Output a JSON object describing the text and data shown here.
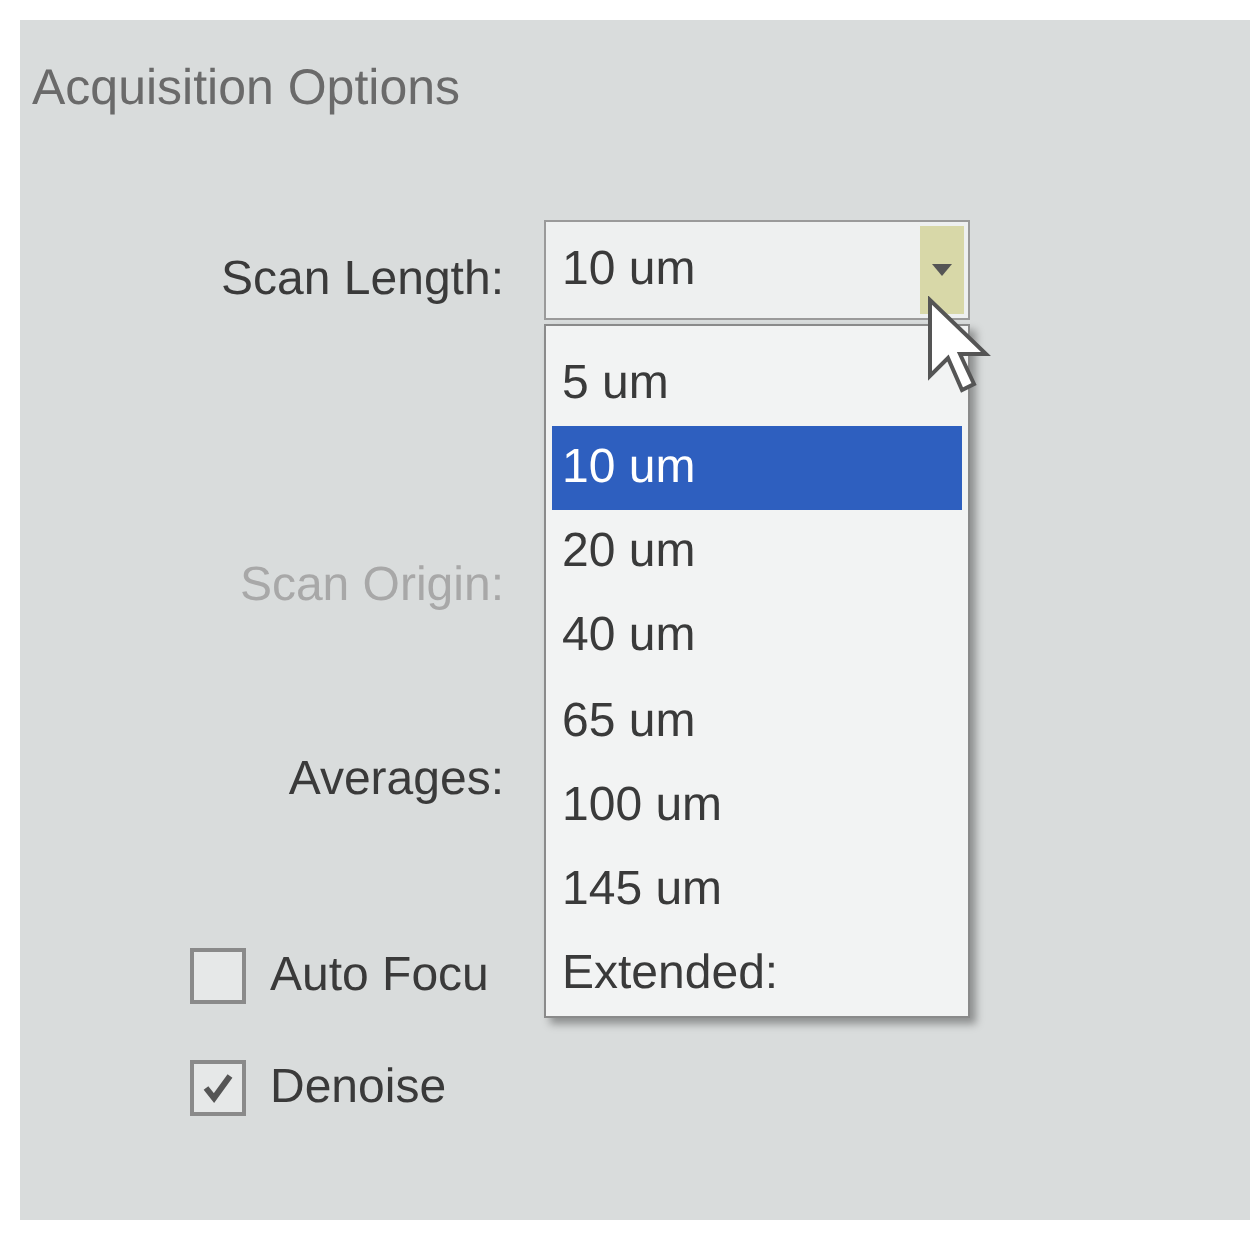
{
  "group": {
    "title": "Acquisition Options"
  },
  "fields": [
    {
      "label": "Scan Length:",
      "disabled": false
    },
    {
      "label": "Scan Origin:",
      "disabled": true
    },
    {
      "label": "Averages:",
      "disabled": false
    }
  ],
  "combo": {
    "value": "10 um",
    "expanded": true
  },
  "options": [
    {
      "label": "5 um",
      "selected": false
    },
    {
      "label": "10 um",
      "selected": true
    },
    {
      "label": "20 um",
      "selected": false
    },
    {
      "label": "40 um",
      "selected": false
    },
    {
      "label": "65 um",
      "selected": false
    },
    {
      "label": "100 um",
      "selected": false
    },
    {
      "label": "145 um",
      "selected": false
    },
    {
      "label": "Extended:",
      "selected": false
    }
  ],
  "checkboxes": [
    {
      "label": "Auto Focu",
      "checked": false
    },
    {
      "label": "Denoise",
      "checked": true
    }
  ]
}
